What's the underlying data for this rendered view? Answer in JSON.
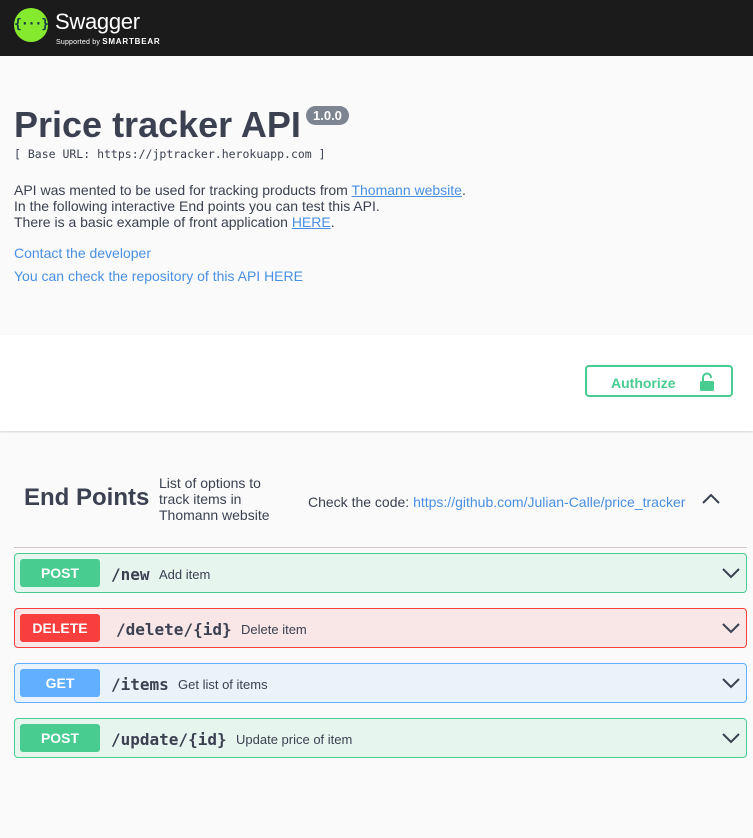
{
  "topbar": {
    "logo_glyph": "{···}",
    "brand_name": "Swagger",
    "brand_sub_prefix": "Supported by",
    "brand_sub_company": "SMARTBEAR"
  },
  "info": {
    "title": "Price tracker API",
    "version": "1.0.0",
    "base_url": "[ Base URL: https://jptracker.herokuapp.com ]",
    "description": {
      "line1_text": "API was mented to be used for tracking products from ",
      "line1_link": "Thomann website",
      "line1_end": ".",
      "line2_text": "In the following interactive End points you can test this API.",
      "line3_text": "There is a basic example of front application ",
      "line3_link": "HERE",
      "line3_end": "."
    },
    "contact_link": "Contact the developer",
    "repo_link": "You can check the repository of this API HERE"
  },
  "scheme": {
    "authorize_label": "Authorize"
  },
  "tag": {
    "name": "End Points",
    "description": "List of options to track items in Thomann website",
    "code_prefix": "Check the code: ",
    "code_link": "https://github.com/Julian-Calle/price_tracker"
  },
  "operations": [
    {
      "method": "POST",
      "path": "/new",
      "summary": "Add item"
    },
    {
      "method": "DELETE",
      "path": "/delete/{id}",
      "summary": "Delete item"
    },
    {
      "method": "GET",
      "path": "/items",
      "summary": "Get list of items"
    },
    {
      "method": "POST",
      "path": "/update/{id}",
      "summary": "Update price of item"
    }
  ],
  "colors": {
    "post": "#49cc90",
    "delete": "#f93e3e",
    "get": "#61afe0",
    "link": "#4990e2",
    "topbar": "#1b1b1b",
    "logo": "#85ea2d"
  }
}
